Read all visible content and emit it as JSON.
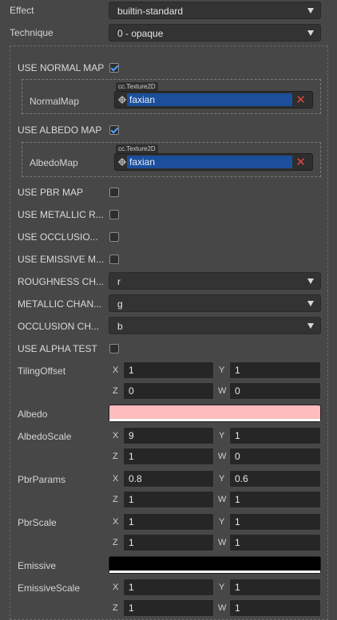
{
  "effect": {
    "label": "Effect",
    "value": "builtin-standard"
  },
  "technique": {
    "label": "Technique",
    "value": "0 - opaque"
  },
  "normal_map": {
    "label": "USE NORMAL MAP",
    "checked": true,
    "tag": "cc.Texture2D",
    "asset_label": "NormalMap",
    "asset": "faxian"
  },
  "albedo_map": {
    "label": "USE ALBEDO MAP",
    "checked": true,
    "tag": "cc.Texture2D",
    "asset_label": "AlbedoMap",
    "asset": "faxian"
  },
  "toggles": [
    {
      "label": "USE PBR MAP",
      "checked": false
    },
    {
      "label": "USE METALLIC R...",
      "checked": false
    },
    {
      "label": "USE OCCLUSIO...",
      "checked": false
    },
    {
      "label": "USE EMISSIVE M...",
      "checked": false
    }
  ],
  "channels": [
    {
      "label": "ROUGHNESS CH...",
      "value": "r"
    },
    {
      "label": "METALLIC CHAN...",
      "value": "g"
    },
    {
      "label": "OCCLUSION CH...",
      "value": "b"
    }
  ],
  "alpha_test": {
    "label": "USE ALPHA TEST",
    "checked": false
  },
  "vectors": {
    "tiling_offset": {
      "label": "TilingOffset",
      "x": "1",
      "y": "1",
      "z": "0",
      "w": "0"
    },
    "albedo_scale": {
      "label": "AlbedoScale",
      "x": "9",
      "y": "1",
      "z": "1",
      "w": "0"
    },
    "pbr_params": {
      "label": "PbrParams",
      "x": "0.8",
      "y": "0.6",
      "z": "1",
      "w": "1"
    },
    "pbr_scale": {
      "label": "PbrScale",
      "x": "1",
      "y": "1",
      "z": "1",
      "w": "1"
    },
    "emissive_scale": {
      "label": "EmissiveScale",
      "x": "1",
      "y": "1",
      "z": "1",
      "w": "1"
    }
  },
  "albedo": {
    "label": "Albedo",
    "color": "#ffbcbc"
  },
  "emissive": {
    "label": "Emissive",
    "color": "#000000"
  },
  "axes": {
    "x": "X",
    "y": "Y",
    "z": "Z",
    "w": "W"
  },
  "icons": {
    "dropdown": "chevron-down-icon",
    "check": "check-icon",
    "target": "target-icon",
    "remove": "remove-icon"
  }
}
